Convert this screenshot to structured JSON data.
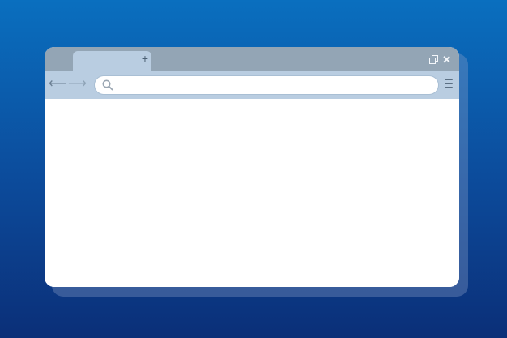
{
  "window": {
    "tabs": [
      {
        "label": ""
      }
    ],
    "new_tab_icon": "plus-icon",
    "controls": [
      "restore-icon",
      "close-icon"
    ]
  },
  "navigation": {
    "back_icon": "arrow-left-icon",
    "forward_icon": "arrow-right-icon",
    "address": {
      "value": "",
      "placeholder": ""
    },
    "search_icon": "search-icon",
    "menu_icon": "hamburger-menu-icon"
  },
  "content": {
    "text": ""
  },
  "colors": {
    "background_top": "#0a6fbf",
    "background_bottom": "#0b2f78",
    "titlebar": "#93a5b5",
    "tab": "#b9cde1",
    "navbar": "#b9cde1",
    "page": "#ffffff"
  }
}
